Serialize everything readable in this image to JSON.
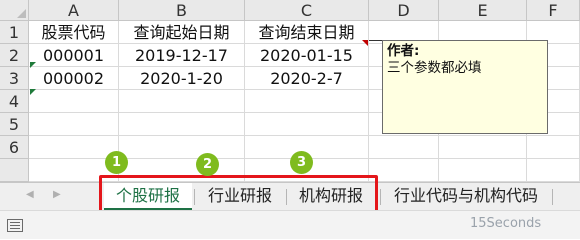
{
  "columns": [
    "A",
    "B",
    "C",
    "D",
    "E",
    "F"
  ],
  "rows": [
    "1",
    "2",
    "3",
    "4",
    "5",
    "6"
  ],
  "cells": {
    "A1": "股票代码",
    "B1": "查询起始日期",
    "C1": "查询结束日期",
    "A2": "000001",
    "B2": "2019-12-17",
    "C2": "2020-01-15",
    "A3": "000002",
    "B3": "2020-1-20",
    "C3": "2020-2-7"
  },
  "comment": {
    "author": "作者:",
    "text": "三个参数都必填"
  },
  "sheet_tabs": [
    {
      "label": "个股研报",
      "active": true
    },
    {
      "label": "行业研报",
      "active": false
    },
    {
      "label": "机构研报",
      "active": false
    },
    {
      "label": "行业代码与机构代码",
      "active": false
    }
  ],
  "badges": [
    "1",
    "2",
    "3"
  ],
  "navigation": {
    "prev": "◀",
    "next": "▶"
  },
  "watermark": "15Seconds",
  "colors": {
    "accent": "#1e7145",
    "highlight_box": "#e4161b",
    "badge": "#7fbb1e",
    "comment_bg": "#ffffe1"
  }
}
